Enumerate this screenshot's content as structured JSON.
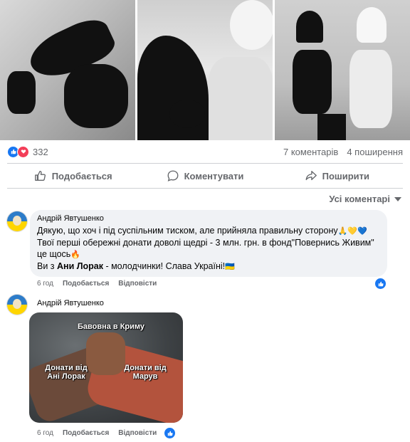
{
  "post": {
    "reaction_count": "332",
    "comments_count": "7 коментарів",
    "shares_count": "4 поширення"
  },
  "actions": {
    "like": "Подобається",
    "comment": "Коментувати",
    "share": "Поширити"
  },
  "comments_filter": "Усі коментарі",
  "comments": [
    {
      "author": "Андрій Явтушенко",
      "line1": "Дякую, що хоч і під суспільним тиском, але прийняла правильну сторону",
      "line1_emoji": "🙏💛💙",
      "line2": "Твої перші обережні донати доволі щедрі - 3 млн. грн. в фонд\"Повернись Живим\"",
      "line3": "це щось",
      "line3_emoji": "🔥",
      "line4_a": "Ви з ",
      "line4_bold": "Ани Лорак",
      "line4_b": " - молодчинки! Слава Україні!",
      "line4_emoji": "🇺🇦",
      "time": "6 год",
      "like": "Подобається",
      "reply": "Відповісти"
    },
    {
      "author": "Андрій Явтушенко",
      "meme_top": "Бавовна в Криму",
      "meme_left": "Донати від Ані Лорак",
      "meme_right": "Донати від Марув",
      "time": "6 год",
      "like": "Подобається",
      "reply": "Відповісти"
    }
  ],
  "colors": {
    "facebook_blue": "#1877f2",
    "love_red": "#f33e58",
    "secondary_text": "#65676b",
    "bubble_bg": "#f0f2f5"
  },
  "icons": [
    "like-icon",
    "love-icon",
    "thumbs-up-icon",
    "comment-icon",
    "share-icon",
    "caret-down-icon",
    "avatar"
  ]
}
